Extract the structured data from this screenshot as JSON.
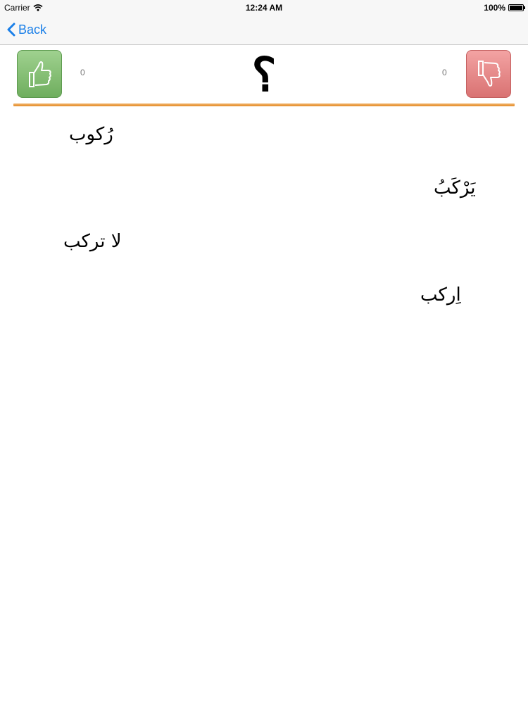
{
  "status_bar": {
    "carrier": "Carrier",
    "time": "12:24 AM",
    "battery": "100%"
  },
  "nav": {
    "back_label": "Back"
  },
  "score": {
    "correct_count": "0",
    "wrong_count": "0",
    "prompt": "؟"
  },
  "colors": {
    "accent": "#1a7fe8",
    "divider": "#e8962e",
    "correct_button": "#7fbf6f",
    "wrong_button": "#e88a8a"
  },
  "answers": [
    "رُكوب",
    "يَرْكَبُ",
    "لا تركب",
    "اِركب"
  ]
}
